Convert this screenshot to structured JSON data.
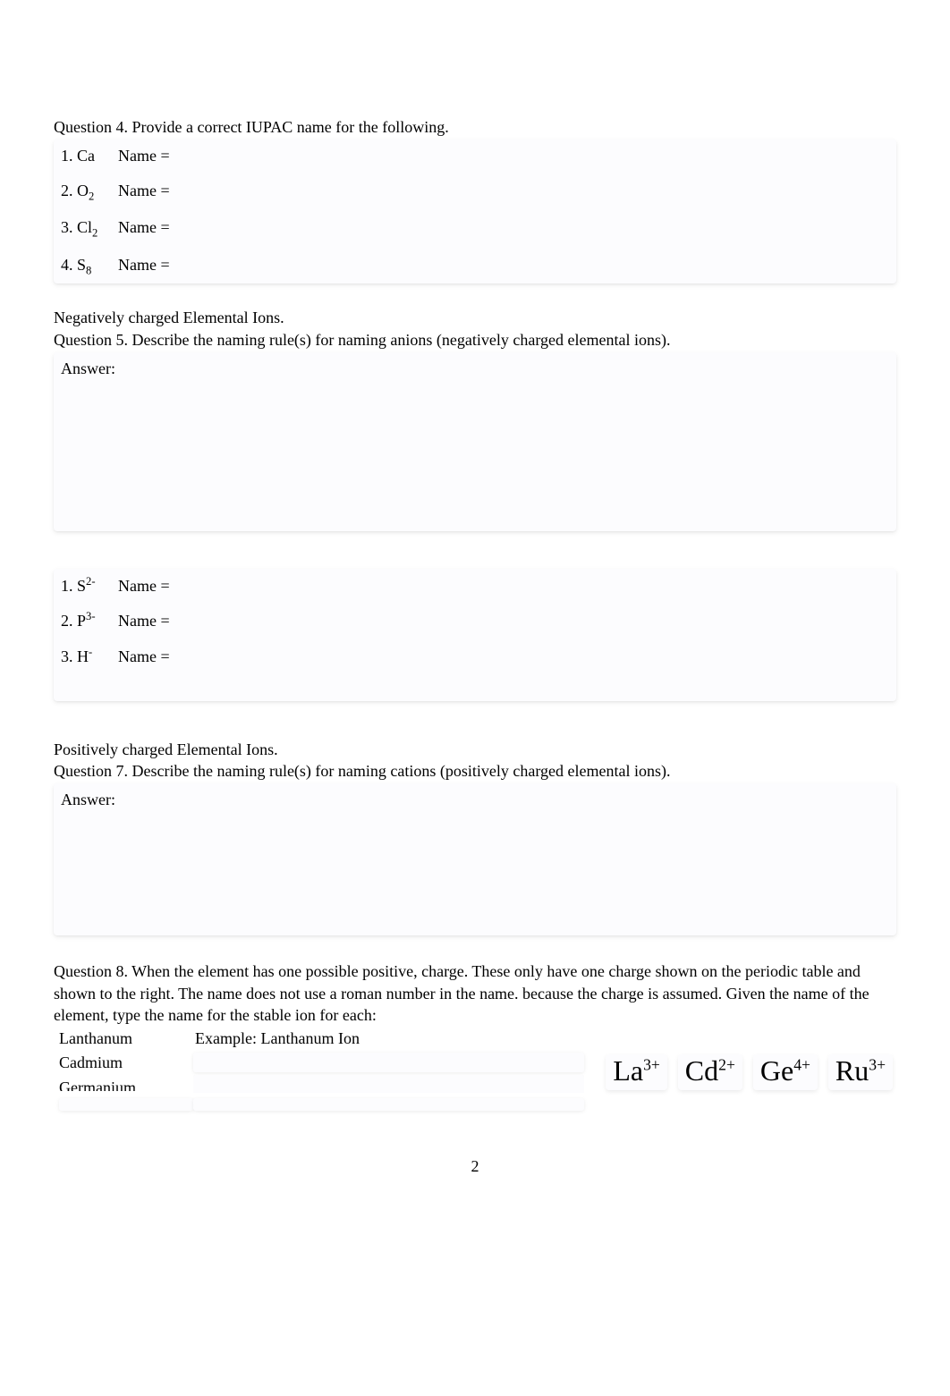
{
  "q4": {
    "prompt": "Question 4. Provide a correct IUPAC name for the following.",
    "items": [
      {
        "num": "1.",
        "formula_html": "Ca",
        "label": "Name ="
      },
      {
        "num": "2.",
        "formula_html": "O<sub>2</sub>",
        "label": "Name ="
      },
      {
        "num": "3.",
        "formula_html": "Cl<sub>2</sub>",
        "label": "Name ="
      },
      {
        "num": "4.",
        "formula_html": "S<sub>8</sub>",
        "label": "Name ="
      }
    ]
  },
  "anions": {
    "heading": "Negatively charged Elemental Ions.",
    "prompt": "Question 5. Describe the naming rule(s) for naming anions (negatively charged elemental ions).",
    "answer_label": " Answer:"
  },
  "q6": {
    "items": [
      {
        "num": "1.",
        "formula_html": "S<sup>2-</sup>",
        "label": "Name ="
      },
      {
        "num": "2.",
        "formula_html": "P<sup>3-</sup>",
        "label": "Name ="
      },
      {
        "num": "3.",
        "formula_html": "H<sup>-</sup>",
        "label": "Name ="
      }
    ]
  },
  "cations": {
    "heading": "Positively charged Elemental Ions.",
    "prompt": "Question 7. Describe the naming rule(s) for naming cations (positively charged elemental ions).",
    "answer_label": " Answer:"
  },
  "q8": {
    "prompt": " Question 8. When the element has one possible positive, charge. These only have one charge shown on the periodic table and shown to the right. The name does not use a roman number in the name. because the charge is assumed. Given the name of the element, type the name for the stable ion for each:",
    "rows": [
      {
        "name": "Lanthanum",
        "example": "Example: Lanthanum Ion"
      },
      {
        "name": "Cadmium",
        "example": ""
      },
      {
        "name": "Germanium",
        "example": ""
      }
    ],
    "ions": [
      {
        "html": "La<sup>3+</sup>"
      },
      {
        "html": "Cd<sup>2+</sup>"
      },
      {
        "html": "Ge<sup>4+</sup>"
      },
      {
        "html": "Ru<sup>3+</sup>"
      }
    ]
  },
  "page_number": "2"
}
